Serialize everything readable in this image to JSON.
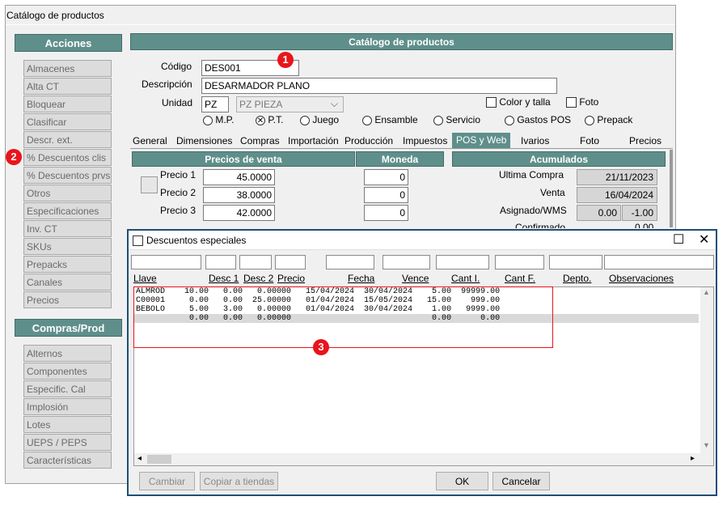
{
  "window": {
    "title": "Catálogo de productos"
  },
  "acciones": {
    "header": "Acciones",
    "items": [
      "Almacenes",
      "Alta CT",
      "Bloquear",
      "Clasificar",
      "Descr. ext.",
      "% Descuentos clis",
      "% Descuentos prvs",
      "Otros",
      "Especificaciones",
      "Inv. CT",
      "SKUs",
      "Prepacks",
      "Canales",
      "Precios"
    ]
  },
  "compras": {
    "header": "Compras/Prod",
    "items": [
      "Alternos",
      "Componentes",
      "Especific. Cal",
      "Implosión",
      "Lotes",
      "UEPS / PEPS",
      "Características"
    ]
  },
  "form": {
    "header": "Catálogo de productos",
    "codigo_label": "Código",
    "codigo_value": "DES001",
    "descripcion_label": "Descripción",
    "descripcion_value": "DESARMADOR PLANO",
    "unidad_label": "Unidad",
    "unidad_value": "PZ",
    "unidad_desc": "PZ  PIEZA",
    "color_talla": "Color y talla",
    "foto": "Foto",
    "radios": [
      "M.P.",
      "P.T.",
      "Juego",
      "Ensamble",
      "Servicio",
      "Gastos POS",
      "Prepack"
    ],
    "selected_radio": "P.T."
  },
  "tabs": [
    "General",
    "Dimensiones",
    "Compras",
    "Importación",
    "Producción",
    "Impuestos",
    "POS y Web",
    "Ivarios",
    "Foto",
    "Precios"
  ],
  "active_tab": "POS y Web",
  "precios": {
    "header": "Precios de venta",
    "moneda_header": "Moneda",
    "rows": [
      {
        "label": "Precio 1",
        "value": "45.0000",
        "moneda": "0"
      },
      {
        "label": "Precio 2",
        "value": "38.0000",
        "moneda": "0"
      },
      {
        "label": "Precio 3",
        "value": "42.0000",
        "moneda": "0"
      }
    ]
  },
  "acumulados": {
    "header": "Acumulados",
    "ultima_compra_label": "Ultima  Compra",
    "ultima_compra": "21/11/2023",
    "venta_label": "Venta",
    "venta": "16/04/2024",
    "asignado_label": "Asignado/WMS",
    "asignado_a": "0.00",
    "asignado_b": "-1.00",
    "confirmado_label": "Confirmado",
    "confirmado_value": "0.00"
  },
  "dialog": {
    "title": "Descuentos especiales",
    "columns": [
      "Llave",
      "Desc 1",
      "Desc 2",
      "Precio",
      "Fecha",
      "Vence",
      "Cant I.",
      "Cant F.",
      "Depto.",
      "Observaciones"
    ],
    "rows": [
      "ALMROD    10.00   0.00   0.00000   15/04/2024  30/04/2024    5.00  99999.00",
      "C00001     0.00   0.00  25.00000   01/04/2024  15/05/2024   15.00    999.00",
      "BEBOLO     5.00   3.00   0.00000   01/04/2024  30/04/2024    1.00   9999.00",
      "           0.00   0.00   0.00000                             0.00      0.00"
    ],
    "buttons": {
      "cambiar": "Cambiar",
      "copiar": "Copiar a tiendas",
      "ok": "OK",
      "cancelar": "Cancelar"
    }
  },
  "badges": [
    "1",
    "2",
    "3"
  ]
}
